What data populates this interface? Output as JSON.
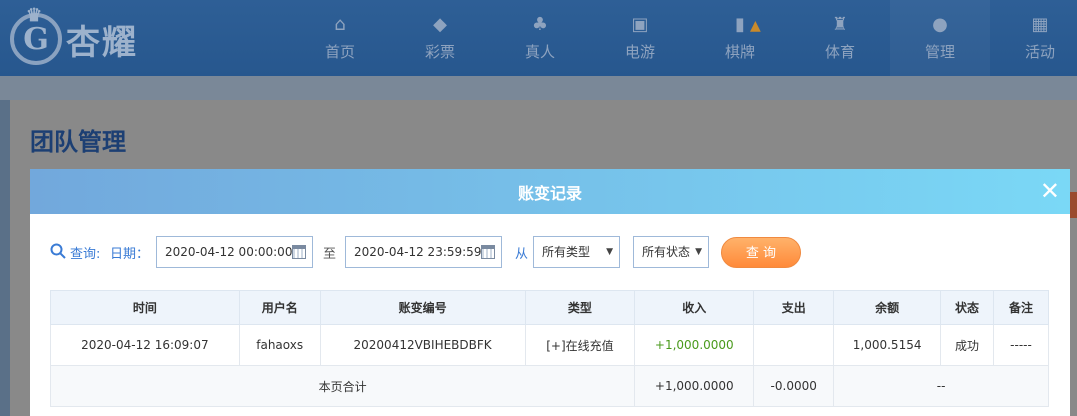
{
  "brand": {
    "logo_text": "杏耀",
    "logo_mark": "G"
  },
  "nav": [
    {
      "label": "首页",
      "icon": "home-icon",
      "glyph": "⌂"
    },
    {
      "label": "彩票",
      "icon": "ticket-icon",
      "glyph": "◆"
    },
    {
      "label": "真人",
      "icon": "dealer-icon",
      "glyph": "♣"
    },
    {
      "label": "电游",
      "icon": "slot-icon",
      "glyph": "▣"
    },
    {
      "label": "棋牌",
      "icon": "cards-icon",
      "glyph": "▮"
    },
    {
      "label": "体育",
      "icon": "trophy-icon",
      "glyph": "♜"
    },
    {
      "label": "管理",
      "icon": "users-icon",
      "glyph": "●"
    },
    {
      "label": "活动",
      "icon": "gift-icon",
      "glyph": "▦"
    }
  ],
  "page": {
    "title": "团队管理"
  },
  "modal": {
    "title": "账变记录",
    "query": {
      "query_label": "查询:",
      "date_label": "日期：",
      "start_date": "2020-04-12 00:00:00",
      "to_label": "至",
      "end_date": "2020-04-12 23:59:59",
      "from_label": "从",
      "type_select": "所有类型",
      "status_select": "所有状态",
      "query_button": "查 询"
    },
    "table": {
      "headers": [
        "时间",
        "用户名",
        "账变编号",
        "类型",
        "收入",
        "支出",
        "余额",
        "状态",
        "备注"
      ],
      "rows": [
        [
          "2020-04-12 16:09:07",
          "fahaoxs",
          "20200412VBIHEBDBFK",
          "[+]在线充值",
          "+1,000.0000",
          "",
          "1,000.5154",
          "成功",
          "-----"
        ]
      ],
      "summary": {
        "label": "本页合计",
        "income": "+1,000.0000",
        "expense": "-0.0000",
        "rest": "--"
      }
    }
  },
  "colors": {
    "accent": "#3a7bd5",
    "income": "#4a9a1c",
    "button": "#ff8a3a"
  }
}
